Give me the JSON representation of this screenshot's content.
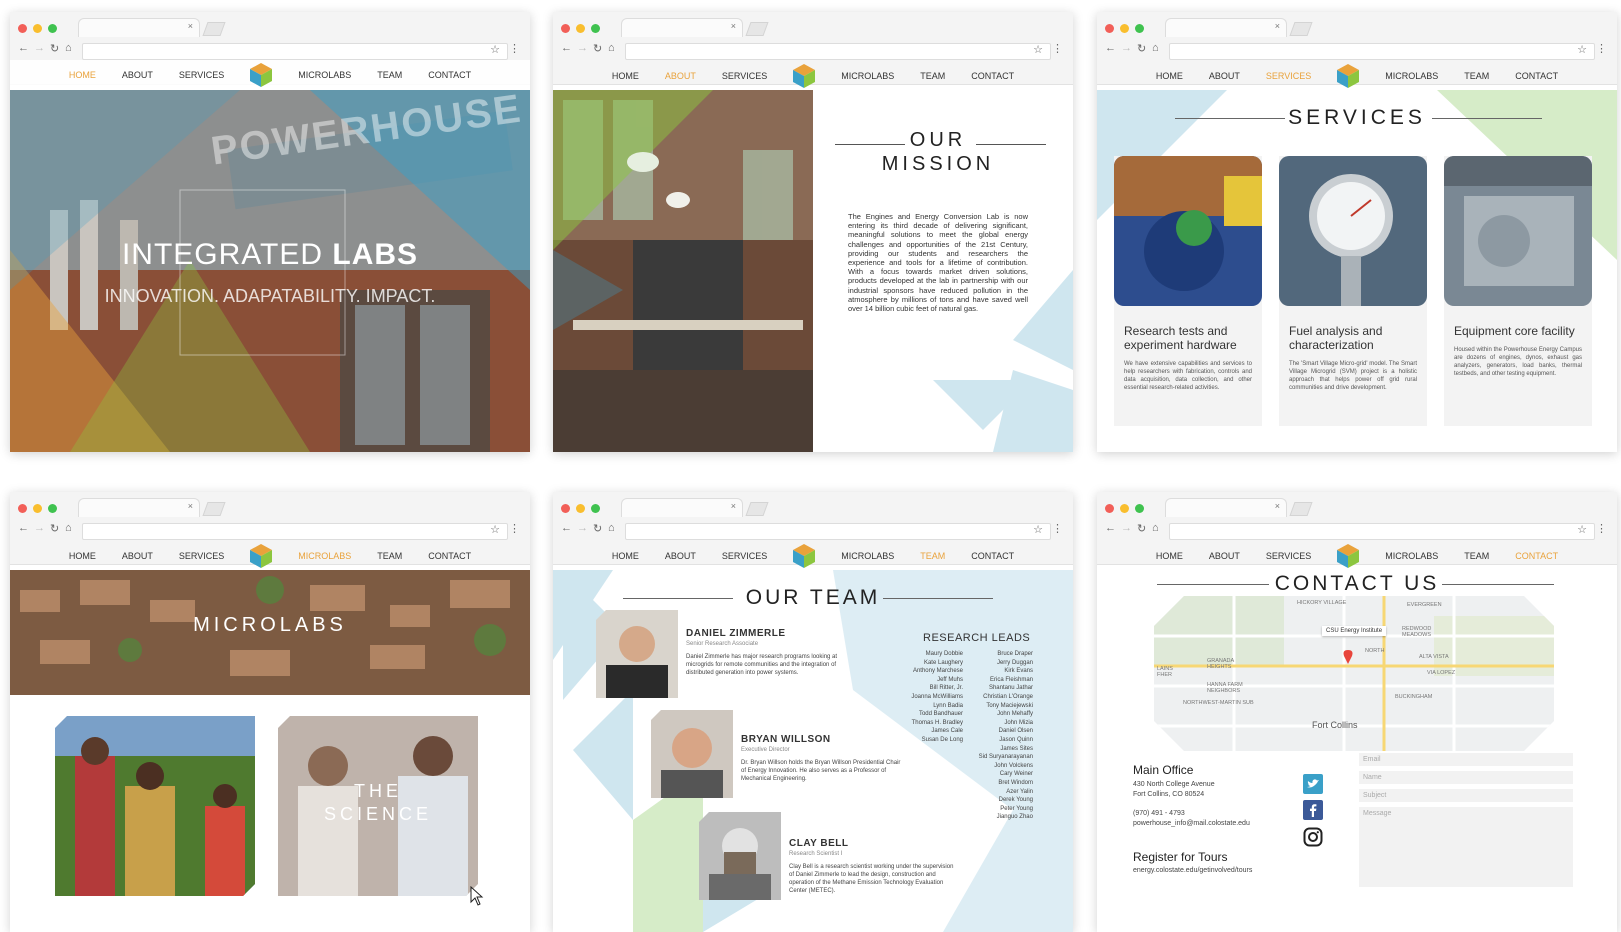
{
  "nav": {
    "home": "HOME",
    "about": "ABOUT",
    "services": "SERVICES",
    "microlabs": "MICROLABS",
    "team": "TEAM",
    "contact": "CONTACT"
  },
  "browser": {
    "tab_close": "×",
    "back": "←",
    "forward": "→",
    "reload": "↻",
    "home": "⌂",
    "star": "☆",
    "menu": "⋮"
  },
  "colors": {
    "accent": "#e9a23b",
    "light_blue": "#cfe6ef",
    "light_green": "#d6ecc8",
    "dot_red": "#f25f58",
    "dot_yellow": "#f9be2e",
    "dot_green": "#3fc24f"
  },
  "home": {
    "title_light": "INTEGRATED ",
    "title_bold": "LABS",
    "tagline": "INNOVATION. ADAPATABILITY. IMPACT.",
    "sign_text": "POWERHOUSE"
  },
  "about": {
    "heading_line1": "OUR",
    "heading_line2": "MISSION",
    "body": "The Engines and Energy Conversion Lab is now entering its third decade of delivering significant, meaningful solutions to meet the global energy challenges and opportunities of the 21st Century, providing our students and researchers the experience and tools for a lifetime of contribution. With a focus towards market driven solutions, products developed at the lab in partnership with our industrial sponsors have reduced pollution in the atmosphere by millions of tons and have saved well over 14 billion cubic feet of natural gas."
  },
  "services": {
    "heading": "SERVICES",
    "cards": [
      {
        "title": "Research tests and experiment hardware",
        "body": "We have extensive capabilities and services to help researchers with fabrication, controls and data acquisition, data collection, and other essential research-related activities."
      },
      {
        "title": "Fuel analysis and characterization",
        "body": "The 'Smart Village Micro-grid' model. The Smart Village Microgrid (SVM) project is a holistic approach that helps power off grid rural communities and drive development."
      },
      {
        "title": "Equipment core facility",
        "body": "Housed within the Powerhouse Energy Campus are dozens of engines, dynos, exhaust gas analyzers, generators, load banks, thermal testbeds, and other testing equipment."
      }
    ]
  },
  "microlabs": {
    "banner": "MICROLABS",
    "tile_label_1": "THE",
    "tile_label_2": "SCIENCE"
  },
  "team": {
    "heading": "OUR TEAM",
    "leads_heading": "RESEARCH LEADS",
    "members": [
      {
        "name": "DANIEL ZIMMERLE",
        "role": "Senior Research Associate",
        "bio": "Daniel Zimmerle has major research programs looking at microgrids for remote communities and the integration of distributed generation into power systems."
      },
      {
        "name": "BRYAN WILLSON",
        "role": "Executive Director",
        "bio": "Dr. Bryan Willson holds the Bryan Willson Presidential Chair of Energy Innovation. He also serves as a Professor of Mechanical Engineering."
      },
      {
        "name": "CLAY BELL",
        "role": "Research Scientist I",
        "bio": "Clay Bell is a research scientist working under the supervision of Daniel Zimmerle to lead the design, construction and operation of the Methane Emission Technology Evaluation Center (METEC)."
      }
    ],
    "leads_col1": [
      "Maury Dobbie",
      "Kate Laughery",
      "Anthony Marchese",
      "Jeff Muhs",
      "Bill Ritter, Jr.",
      "Joanna McWilliams",
      "Lynn Badia",
      "Todd Bandhauer",
      "Thomas H. Bradley",
      "James Cale",
      "Susan De Long"
    ],
    "leads_col2": [
      "Bruce Draper",
      "Jerry Duggan",
      "Kirk Evans",
      "Erica Fleishman",
      "Shantanu Jathar",
      "Christian L'Orange",
      "Tony Maciejewski",
      "John Mehaffy",
      "John Mizia",
      "Daniel Olsen",
      "Jason Quinn",
      "James Sites",
      "Sid Suryanarayanan",
      "John Volckens",
      "Cary Weiner",
      "Bret Windom",
      "Azer Yalin",
      "Derek Young",
      "Peter Young",
      "Jianguo Zhao"
    ]
  },
  "contact": {
    "heading": "CONTACT US",
    "office_heading": "Main Office",
    "address_1": "430 North College Avenue",
    "address_2": "Fort Collins, CO 80524",
    "phone": "(970) 491 - 4793",
    "email": "powerhouse_info@mail.colostate.edu",
    "tours_heading": "Register for Tours",
    "tours_url": "energy.colostate.edu/getinvolved/tours",
    "form": {
      "email": "Email",
      "name": "Name",
      "subject": "Subject",
      "message": "Message"
    },
    "map": {
      "pin_label": "CSU Energy Institute",
      "labels": [
        "HICKORY VILLAGE",
        "EVERGREEN",
        "REDWOOD MEADOWS",
        "NORTH",
        "ALTA VISTA",
        "GRANADA HEIGHTS",
        "VIA LOPEZ",
        "HANNA FARM NEIGHBORS",
        "BUCKINGHAM",
        "NORTHWEST-MARTIN SUB",
        "Fort Collins",
        "LAINS FHER"
      ]
    }
  }
}
